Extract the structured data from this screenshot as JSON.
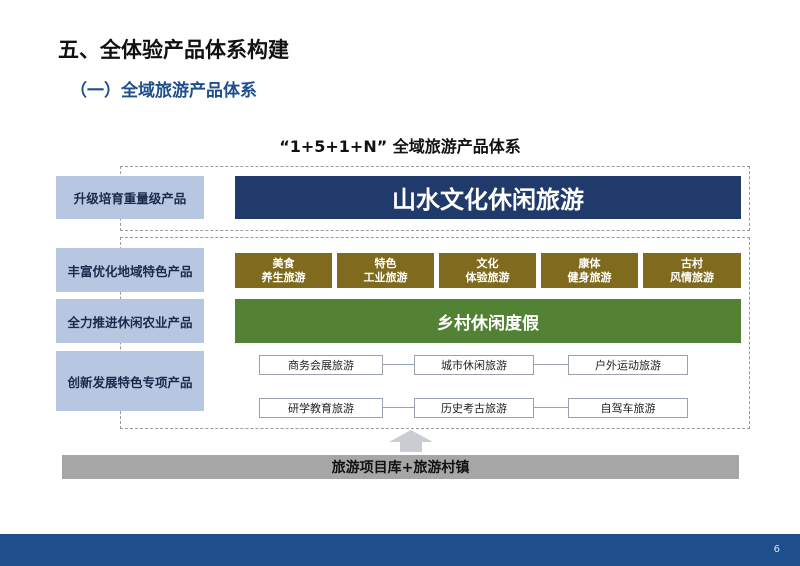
{
  "slide": {
    "title": "五、全体验产品体系构建",
    "subtitle": "（一）全域旅游产品体系",
    "system_title": "“1+5+1+N” 全域旅游产品体系",
    "page_number": "6"
  },
  "left_labels": [
    "升级培育重量级产品",
    "丰富优化地域特色产品",
    "全力推进休闲农业产品",
    "创新发展特色专项产品"
  ],
  "top_banner": "山水文化休闲旅游",
  "gold_boxes": [
    {
      "line1": "美食",
      "line2": "养生旅游"
    },
    {
      "line1": "特色",
      "line2": "工业旅游"
    },
    {
      "line1": "文化",
      "line2": "体验旅游"
    },
    {
      "line1": "康体",
      "line2": "健身旅游"
    },
    {
      "line1": "古村",
      "line2": "风情旅游"
    }
  ],
  "green_banner": "乡村休闲度假",
  "special_row1": [
    "商务会展旅游",
    "城市休闲旅游",
    "户外运动旅游"
  ],
  "special_row2": [
    "研学教育旅游",
    "历史考古旅游",
    "自驾车旅游"
  ],
  "bottom_bar": "旅游项目库+旅游村镇",
  "colors": {
    "navy": "#1f3a6b",
    "gold": "#7f6a1d",
    "green": "#548235",
    "label_bg": "#b7c7e2",
    "bottom_bar": "#a6a6a6",
    "footer": "#1f4e8c"
  }
}
